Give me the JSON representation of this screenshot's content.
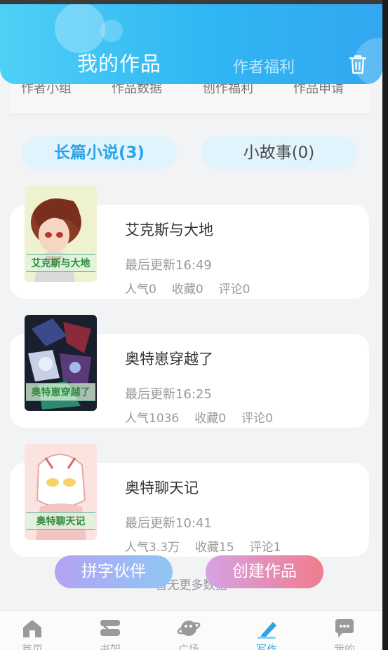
{
  "header": {
    "title": "我的作品",
    "subtitle": "作者福利",
    "trash_icon": "trash-icon"
  },
  "quick_links": [
    "作者小组",
    "作品数据",
    "创作福利",
    "作品申请"
  ],
  "segments": [
    {
      "label": "长篇小说(3)",
      "active": true
    },
    {
      "label": "小故事(0)",
      "active": false
    }
  ],
  "books": [
    {
      "title": "艾克斯与大地",
      "update": "最后更新16:49",
      "popularity": "人气0",
      "favorites": "收藏0",
      "comments": "评论0",
      "cover_text": "艾克斯与大地"
    },
    {
      "title": "奥特崽穿越了",
      "update": "最后更新16:25",
      "popularity": "人气1036",
      "favorites": "收藏0",
      "comments": "评论0",
      "cover_text": "奥特崽穿越了"
    },
    {
      "title": "奥特聊天记",
      "update": "最后更新10:41",
      "popularity": "人气3.3万",
      "favorites": "收藏15",
      "comments": "评论1",
      "cover_text": "奥特聊天记"
    }
  ],
  "load_more": "暂无更多数据",
  "actions": {
    "partner": "拼字伙伴",
    "create": "创建作品"
  },
  "tabbar": [
    {
      "label": "首页",
      "icon": "home-icon"
    },
    {
      "label": "书架",
      "icon": "bookshelf-icon"
    },
    {
      "label": "广场",
      "icon": "planet-icon"
    },
    {
      "label": "写作",
      "icon": "pen-icon",
      "active": true
    },
    {
      "label": "我的",
      "icon": "chat-bubble-icon"
    }
  ],
  "colors": {
    "accent": "#2ba4e6",
    "header_start": "#4fd0f6",
    "header_end": "#33a7f1"
  }
}
